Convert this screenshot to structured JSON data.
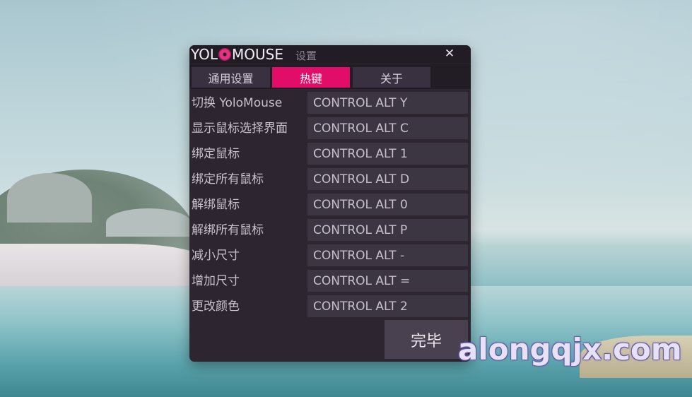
{
  "window": {
    "logo_text_1": "YOL",
    "logo_text_2": "MOUSE",
    "title": "设置",
    "close_glyph": "✕"
  },
  "tabs": [
    {
      "label": "通用设置",
      "active": false
    },
    {
      "label": "热键",
      "active": true
    },
    {
      "label": "关于",
      "active": false
    }
  ],
  "hotkeys": [
    {
      "label": "切换 YoloMouse",
      "value": "CONTROL ALT Y"
    },
    {
      "label": "显示鼠标选择界面",
      "value": "CONTROL ALT C"
    },
    {
      "label": "绑定鼠标",
      "value": "CONTROL ALT 1"
    },
    {
      "label": "绑定所有鼠标",
      "value": "CONTROL ALT D"
    },
    {
      "label": "解绑鼠标",
      "value": "CONTROL ALT 0"
    },
    {
      "label": "解绑所有鼠标",
      "value": "CONTROL ALT P"
    },
    {
      "label": "减小尺寸",
      "value": "CONTROL ALT -"
    },
    {
      "label": "增加尺寸",
      "value": "CONTROL ALT ="
    },
    {
      "label": "更改颜色",
      "value": "CONTROL ALT 2"
    }
  ],
  "done_label": "完毕",
  "watermark": "alongqjx.com",
  "colors": {
    "accent": "#e20d69",
    "window_bg": "#2d2530",
    "field_bg": "#3c3542"
  }
}
